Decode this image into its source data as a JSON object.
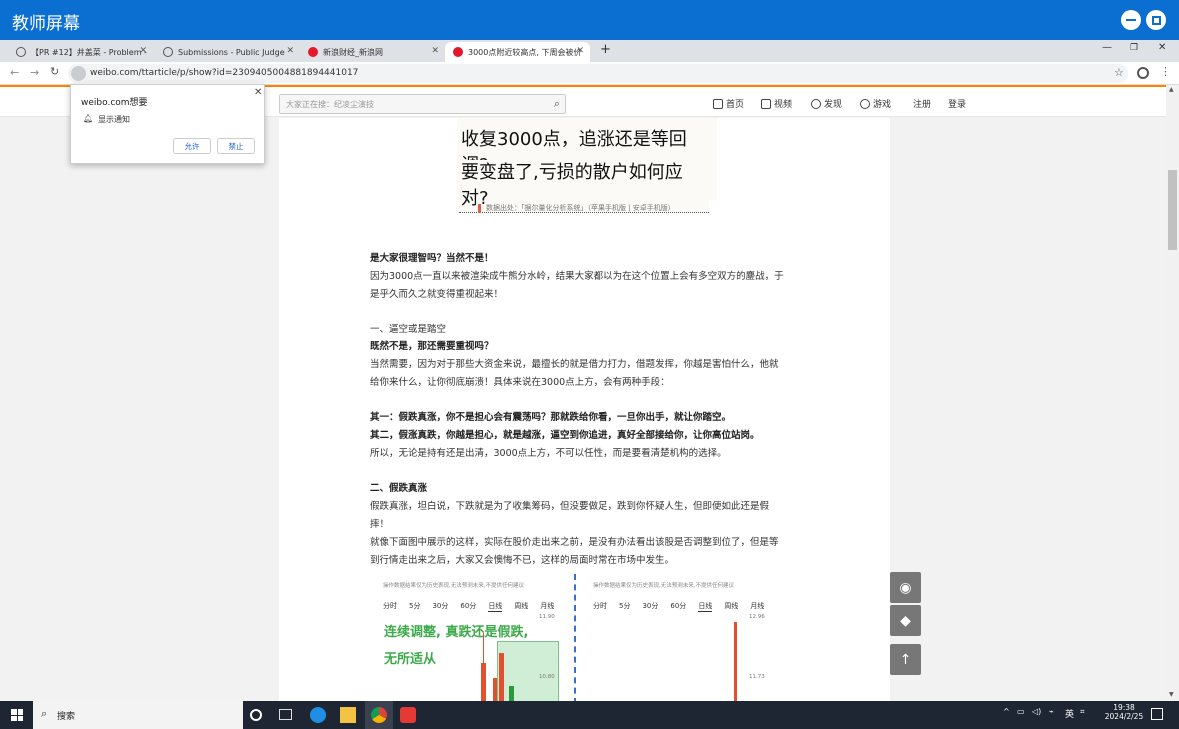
{
  "outer": {
    "title": "教师屏幕"
  },
  "tabs": [
    {
      "label": "【PR #12】井盖菜 - Problem -"
    },
    {
      "label": "Submissions - Public Judge"
    },
    {
      "label": "新浪财经_新浪网"
    },
    {
      "label": "3000点附近较高点, 下周会被价"
    }
  ],
  "new_tab": "+",
  "address": {
    "url": "weibo.com/ttarticle/p/show?id=2309405004881894441017"
  },
  "popup": {
    "title": "weibo.com想要",
    "item": "显示通知",
    "allow": "允许",
    "block": "禁止"
  },
  "topnav": {
    "search_placeholder": "大家正在搜：纪凌尘演技",
    "items": [
      "首页",
      "视频",
      "发现",
      "游戏",
      "注册",
      "登录"
    ]
  },
  "article": {
    "headline1": "收复3000点，追涨还是等回调?",
    "headline2": "要变盘了,亏损的散户如何应对?",
    "source": "数据出处：「据尔量化分析系统」（苹果手机版 | 安卓手机版）",
    "para": [
      {
        "text": "是大家很理智吗？当然不是！",
        "bold": true
      },
      {
        "text": "因为3000点一直以来被渲染成牛熊分水岭，结果大家都以为在这个位置上会有多空双方的鏖战，于",
        "bold": false
      },
      {
        "text": "是乎久而久之就变得重视起来！",
        "bold": false
      },
      {
        "text": "一、逼空或是踏空",
        "bold": false
      },
      {
        "text": "既然不是，那还需要重视吗？",
        "bold": true
      },
      {
        "text": "当然需要，因为对于那些大资金来说，最擅长的就是借力打力，借题发挥，你越是害怕什么，他就",
        "bold": false
      },
      {
        "text": "给你来什么，让你彻底崩溃！具体来说在3000点上方，会有两种手段：",
        "bold": false
      },
      {
        "text": "其一：假跌真涨，你不是担心会有震荡吗？那就跌给你看，一旦你出手，就让你踏空。",
        "bold": true
      },
      {
        "text": "其二，假涨真跌，你越是担心，就是越涨，逼空到你追进，真好全部接给你，让你高位站岗。",
        "bold": true
      },
      {
        "text": "所以，无论是持有还是出清，3000点上方，不可以任性，而是要看清楚机构的选择。",
        "bold": false
      },
      {
        "text": "二、假跌真涨",
        "bold": true
      },
      {
        "text": "假跌真涨，坦白说，下跌就是为了收集筹码，但没要做足，跌到你怀疑人生，但即便如此还是假",
        "bold": false
      },
      {
        "text": "摔！",
        "bold": false
      },
      {
        "text": "就像下面图中展示的这样，实际在股价走出来之前，是没有办法看出该股是否调整到位了，但是等",
        "bold": false
      },
      {
        "text": "到行情走出来之后，大家又会懊悔不已，这样的局面时常在市场中发生。",
        "bold": false
      }
    ]
  },
  "chart_panels": {
    "notice": "操作数据结果仅为历史表现,无法预测未来,不提供任何建议",
    "tabs": [
      "分时",
      "5分",
      "30分",
      "60分",
      "日线",
      "周线",
      "月线"
    ],
    "overlay1": "连续调整, 真跌还是假跌,",
    "overlay2": "无所适从",
    "left_price_top": "11.90",
    "left_price_mid": "10.80",
    "right_price_top": "12.96",
    "right_price_mid": "11.73"
  },
  "taskbar": {
    "search": "搜索",
    "lang": "英",
    "time": "19:38",
    "date": "2024/2/25"
  }
}
